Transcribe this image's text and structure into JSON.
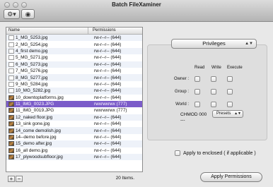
{
  "window": {
    "title": "Batch FileXaminer"
  },
  "toolbar": {
    "gear_icon": "gear-icon",
    "eye_icon": "eye-icon"
  },
  "file_list": {
    "columns": [
      "Name",
      "Permissions"
    ],
    "rows": [
      {
        "name": "1_MG_5253.jpg",
        "perm": "rw-r--r-- (644)",
        "icon": "doc"
      },
      {
        "name": "2_MG_5254.jpg",
        "perm": "rw-r--r-- (644)",
        "icon": "doc"
      },
      {
        "name": "4_first demo.jpg",
        "perm": "rw-r--r-- (644)",
        "icon": "doc"
      },
      {
        "name": "5_MG_5271.jpg",
        "perm": "rw-r--r-- (644)",
        "icon": "doc"
      },
      {
        "name": "6_MG_5273.jpg",
        "perm": "rw-r--r-- (644)",
        "icon": "doc"
      },
      {
        "name": "7_MG_5276.jpg",
        "perm": "rw-r--r-- (644)",
        "icon": "doc"
      },
      {
        "name": "8_MG_5277.jpg",
        "perm": "rw-r--r-- (644)",
        "icon": "doc"
      },
      {
        "name": "9_MG_5284.jpg",
        "perm": "rw-r--r-- (644)",
        "icon": "doc"
      },
      {
        "name": "10_MG_5282.jpg",
        "perm": "rw-r--r-- (644)",
        "icon": "doc"
      },
      {
        "name": "10_downtoplatforms.jpg",
        "perm": "rw-r--r-- (644)",
        "icon": "img"
      },
      {
        "name": "11_IMG_0023.JPG",
        "perm": "rwxrwxrwx (777)",
        "icon": "img",
        "selected": true
      },
      {
        "name": "11_IMG_0019.JPG",
        "perm": "rwxrwxrwx (777)",
        "icon": "img"
      },
      {
        "name": "12_naked floor.jpg",
        "perm": "rw-r--r-- (644)",
        "icon": "img"
      },
      {
        "name": "13_sink gone.jpg",
        "perm": "rw-r--r-- (644)",
        "icon": "img"
      },
      {
        "name": "14_come demolish.jpg",
        "perm": "rw-r--r-- (644)",
        "icon": "img"
      },
      {
        "name": "14--demo before.jpg",
        "perm": "rw-r--r-- (644)",
        "icon": "img"
      },
      {
        "name": "15_demo after.jpg",
        "perm": "rw-r--r-- (644)",
        "icon": "img"
      },
      {
        "name": "16_all demo.jpg",
        "perm": "rw-r--r-- (644)",
        "icon": "img"
      },
      {
        "name": "17_plywoodsubfloor.jpg",
        "perm": "rw-r--r-- (644)",
        "icon": "img"
      }
    ],
    "add_label": "+",
    "remove_label": "−",
    "count": "20 Items."
  },
  "privileges": {
    "popup_label": "Privileges",
    "columns": [
      "Read",
      "Write",
      "Execute"
    ],
    "rows": [
      "Owner :",
      "Group :",
      "World :"
    ],
    "chmod_label": "CHMOD",
    "chmod_value": "000",
    "chmod_sub": "---",
    "presets_label": "Presets"
  },
  "apply_enclosed_label": "Apply to enclosed ( if applicable )",
  "apply_button_label": "Apply Permissions"
}
